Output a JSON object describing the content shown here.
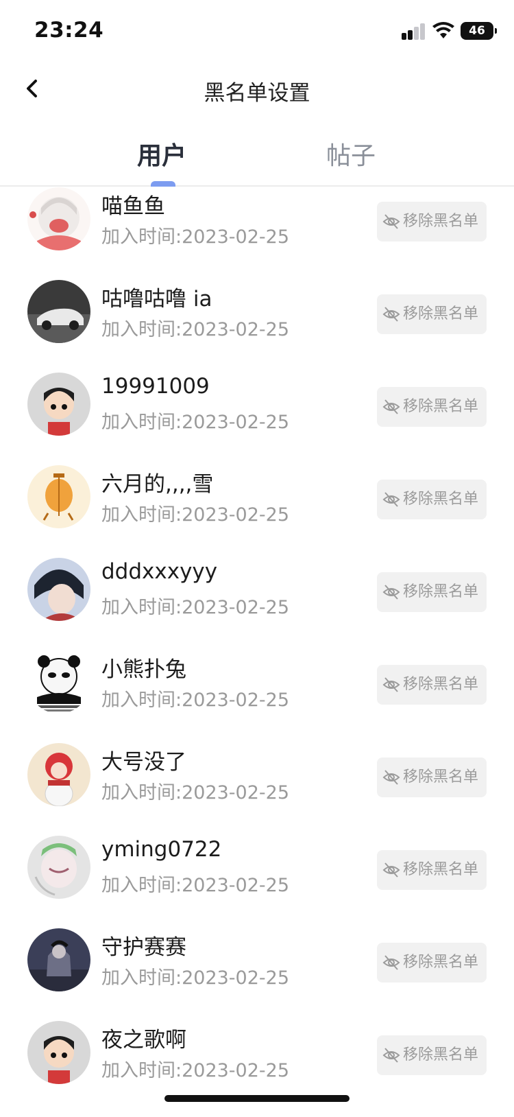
{
  "status_bar": {
    "time": "23:24",
    "battery": "46"
  },
  "nav": {
    "title": "黑名单设置"
  },
  "tabs": [
    {
      "label": "用户",
      "active": true
    },
    {
      "label": "帖子",
      "active": false
    }
  ],
  "list": [
    {
      "name": "喵鱼鱼",
      "time": "加入时间:2023-02-25",
      "action": "移除黑名单"
    },
    {
      "name": "咕噜咕噜 ia",
      "time": "加入时间:2023-02-25",
      "action": "移除黑名单"
    },
    {
      "name": "19991009",
      "time": "加入时间:2023-02-25",
      "action": "移除黑名单"
    },
    {
      "name": "六月的,,,,雪",
      "time": "加入时间:2023-02-25",
      "action": "移除黑名单"
    },
    {
      "name": "dddxxxyyy",
      "time": "加入时间:2023-02-25",
      "action": "移除黑名单"
    },
    {
      "name": "小熊扑兔",
      "time": "加入时间:2023-02-25",
      "action": "移除黑名单"
    },
    {
      "name": "大号没了",
      "time": "加入时间:2023-02-25",
      "action": "移除黑名单"
    },
    {
      "name": "yming0722",
      "time": "加入时间:2023-02-25",
      "action": "移除黑名单"
    },
    {
      "name": "守护赛赛",
      "time": "加入时间:2023-02-25",
      "action": "移除黑名单"
    },
    {
      "name": "夜之歌啊",
      "time": "加入时间:2023-02-25",
      "action": "移除黑名单"
    }
  ],
  "colors": {
    "tab_indicator": "#7d9cf0",
    "button_bg": "#f1f1f1",
    "muted_text": "#9a9a9a"
  },
  "icons": {
    "back": "chevron-left-icon",
    "remove": "eye-slash-icon"
  }
}
